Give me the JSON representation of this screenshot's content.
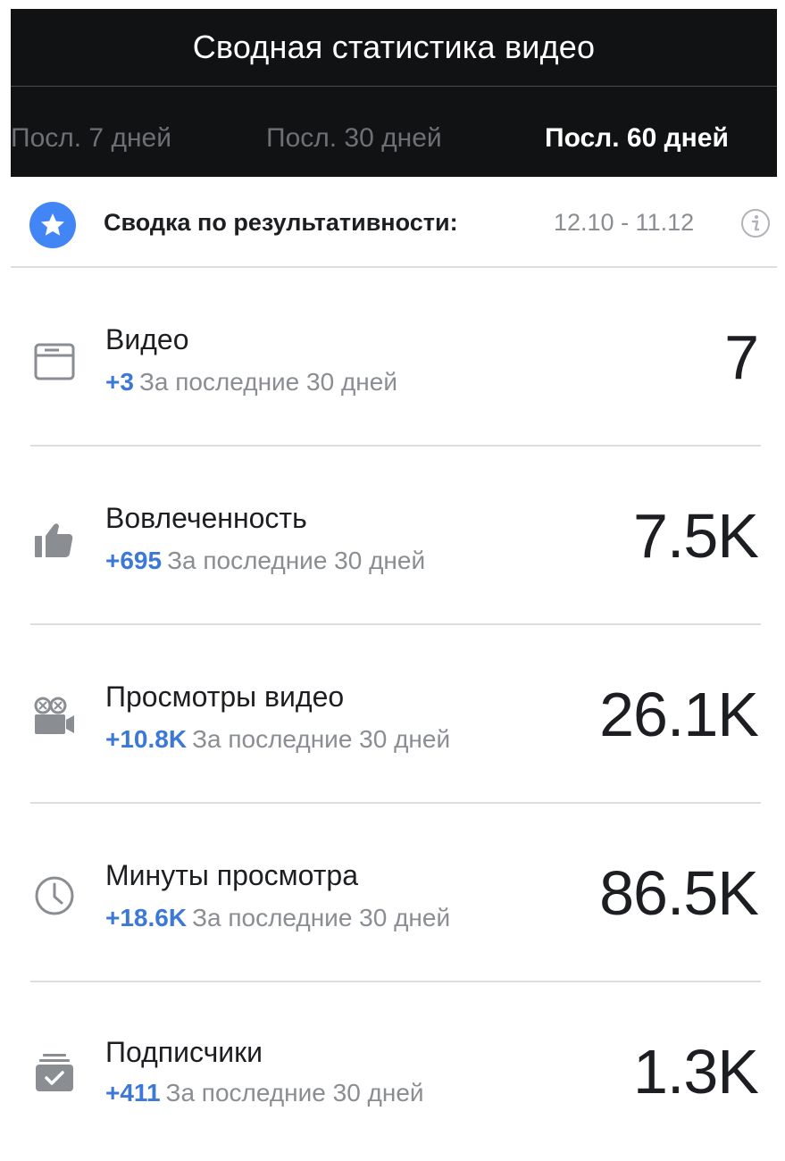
{
  "header": {
    "title": "Сводная статистика видео",
    "tabs": [
      {
        "label": "Посл. 7 дней",
        "active": false
      },
      {
        "label": "Посл. 30 дней",
        "active": false
      },
      {
        "label": "Посл. 60 дней",
        "active": true
      }
    ]
  },
  "summary": {
    "label": "Сводка по результативности:",
    "range": "12.10 - 11.12",
    "icon": "star-icon",
    "info_icon": "info-icon"
  },
  "metrics": [
    {
      "name": "Видео",
      "delta": "+3",
      "period": "За последние 30 дней",
      "value": "7",
      "icon": "video-library-icon"
    },
    {
      "name": "Вовлеченность",
      "delta": "+695",
      "period": "За последние 30 дней",
      "value": "7.5K",
      "icon": "thumbs-up-icon"
    },
    {
      "name": "Просмотры видео",
      "delta": "+10.8K",
      "period": "За последние 30 дней",
      "value": "26.1K",
      "icon": "movie-camera-icon"
    },
    {
      "name": "Минуты просмотра",
      "delta": "+18.6K",
      "period": "За последние 30 дней",
      "value": "86.5K",
      "icon": "clock-icon"
    },
    {
      "name": "Подписчики",
      "delta": "+411",
      "period": "За последние 30 дней",
      "value": "1.3K",
      "icon": "subscribed-box-icon"
    }
  ],
  "colors": {
    "header_bg": "#111214",
    "accent_blue": "#3b78d8",
    "star_badge": "#4285f4",
    "muted_text": "#8a8d91"
  }
}
